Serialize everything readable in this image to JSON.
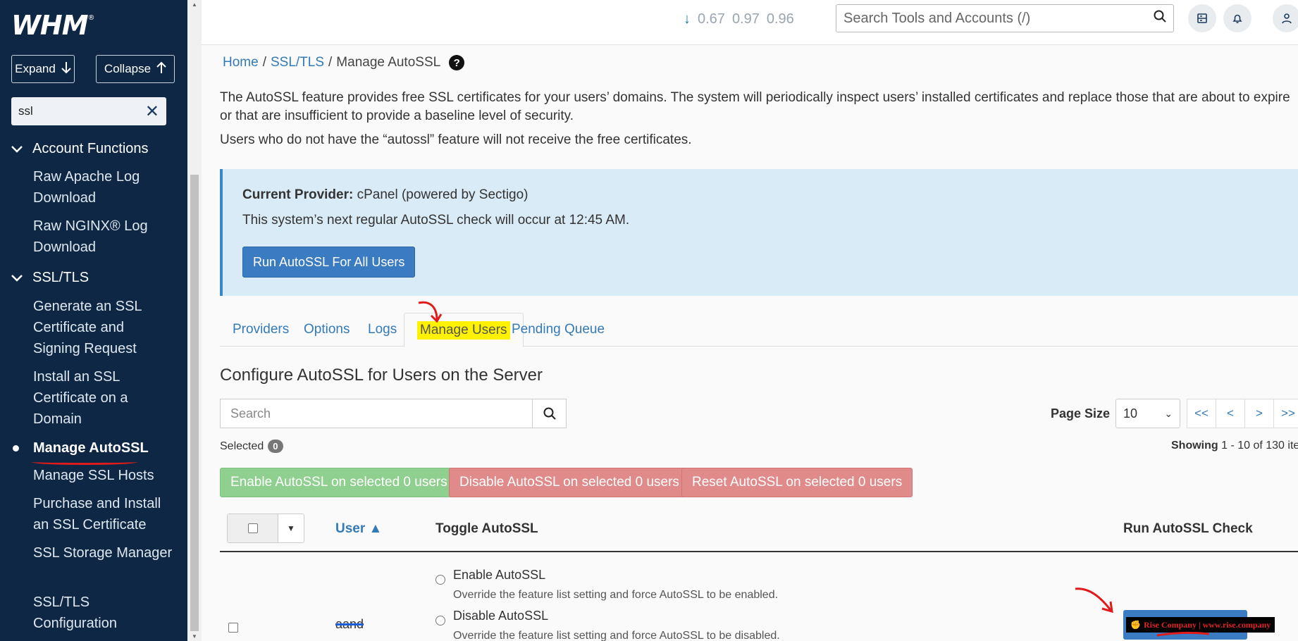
{
  "sidebar": {
    "logo": "WHM",
    "logo_mark": "®",
    "expand_label": "Expand",
    "collapse_label": "Collapse",
    "search_value": "ssl",
    "sections": [
      {
        "title": "Account Functions",
        "items": [
          "Raw Apache Log Download",
          "Raw NGINX® Log Download"
        ]
      },
      {
        "title": "SSL/TLS",
        "items": [
          "Generate an SSL Certificate and Signing Request",
          "Install an SSL Certificate on a Domain",
          "Manage AutoSSL",
          "Manage SSL Hosts",
          "Purchase and Install an SSL Certificate",
          "SSL Storage Manager",
          "SSL/TLS Configuration"
        ]
      }
    ],
    "active_item": "Manage AutoSSL"
  },
  "topbar": {
    "load_averages": [
      "0.67",
      "0.97",
      "0.96"
    ],
    "search_placeholder": "Search Tools and Accounts (/)"
  },
  "breadcrumb": {
    "home": "Home",
    "section": "SSL/TLS",
    "current": "Manage AutoSSL",
    "sep": "/"
  },
  "description": "The AutoSSL feature provides free SSL certificates for your users’ domains. The system will periodically inspect users’ installed certificates and replace those that are about to expire or that are insufficient to provide a baseline level of security.",
  "description2": "Users who do not have the “autossl” feature will not receive the free certificates.",
  "provider_panel": {
    "label": "Current Provider:",
    "value": "cPanel (powered by Sectigo)",
    "schedule": "This system’s next regular AutoSSL check will occur at 12:45 AM.",
    "run_all_label": "Run AutoSSL For All Users"
  },
  "tabs": [
    "Providers",
    "Options",
    "Logs",
    "Manage Users",
    "Pending Queue"
  ],
  "active_tab": "Manage Users",
  "manage_users": {
    "title": "Configure AutoSSL for Users on the Server",
    "search_placeholder": "Search",
    "page_size_label": "Page Size",
    "page_size_value": "10",
    "pager": [
      "<<",
      "<",
      ">",
      ">>"
    ],
    "selected_label": "Selected",
    "selected_count": "0",
    "showing_prefix": "Showing",
    "showing_range": "1 - 10 of 130 ite",
    "enable_selected": "Enable AutoSSL on selected 0 users",
    "disable_selected": "Disable AutoSSL on selected 0 users",
    "reset_selected": "Reset AutoSSL on selected 0 users",
    "col_user": "User ▲",
    "col_toggle": "Toggle AutoSSL",
    "col_run": "Run AutoSSL Check",
    "rows": [
      {
        "user": "aand",
        "enable_label": "Enable AutoSSL",
        "enable_desc": "Override the feature list setting and force AutoSSL to be enabled.",
        "disable_label": "Disable AutoSSL",
        "disable_desc": "Override the feature list setting and force AutoSSL to be disabled."
      }
    ],
    "watermark": "Rise Company | www.rise.company"
  },
  "colors": {
    "sidebar_bg": "#0e2744",
    "link": "#337ab7",
    "primary": "#3a7bc2",
    "info_bg": "#d9ebf7",
    "success": "#8fcf8f",
    "danger": "#e08a8a",
    "highlight": "#fff200",
    "annotation": "#e01b1b"
  },
  "icons": [
    "arrow-down-icon",
    "arrow-up-icon",
    "close-icon",
    "chevron-down-icon",
    "search-icon",
    "server-icon",
    "bell-icon",
    "help-icon",
    "caret-down-icon"
  ]
}
